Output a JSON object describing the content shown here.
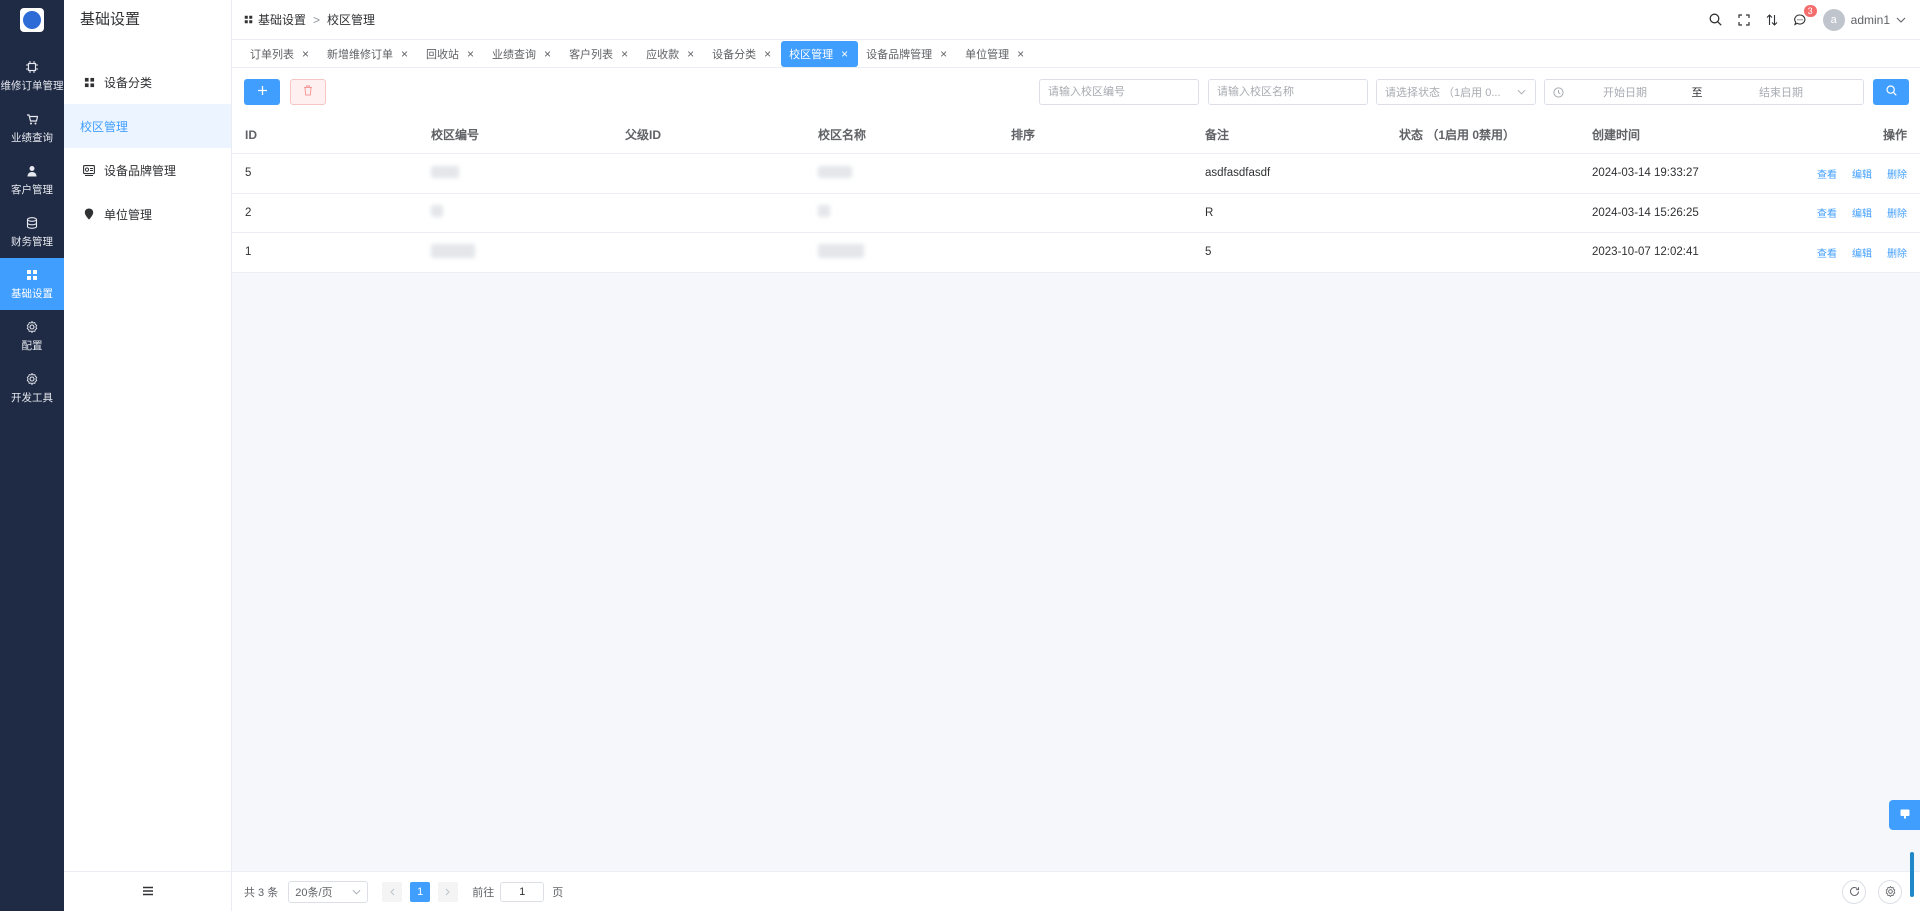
{
  "rail": {
    "items": [
      {
        "label": "维修订单管理",
        "icon": "chip-icon"
      },
      {
        "label": "业绩查询",
        "icon": "cart-icon"
      },
      {
        "label": "客户管理",
        "icon": "person-icon"
      },
      {
        "label": "财务管理",
        "icon": "database-icon"
      },
      {
        "label": "基础设置",
        "icon": "grid-icon"
      },
      {
        "label": "配置",
        "icon": "gear-icon"
      },
      {
        "label": "开发工具",
        "icon": "gear-icon"
      }
    ],
    "active_index": 4
  },
  "sidebar": {
    "title": "基础设置",
    "items": [
      {
        "label": "设备分类",
        "icon": "grid-icon"
      },
      {
        "label": "校区管理",
        "icon": ""
      },
      {
        "label": "设备品牌管理",
        "icon": "brand-icon"
      },
      {
        "label": "单位管理",
        "icon": "pin-icon"
      }
    ]
  },
  "header": {
    "breadcrumb": [
      "基础设置",
      "校区管理"
    ],
    "user": "admin1",
    "avatar_letter": "a",
    "notification_count": "3"
  },
  "tabs": [
    {
      "label": "订单列表"
    },
    {
      "label": "新增维修订单"
    },
    {
      "label": "回收站"
    },
    {
      "label": "业绩查询"
    },
    {
      "label": "客户列表"
    },
    {
      "label": "应收款"
    },
    {
      "label": "设备分类"
    },
    {
      "label": "校区管理",
      "active": true
    },
    {
      "label": "设备品牌管理"
    },
    {
      "label": "单位管理"
    }
  ],
  "filters": {
    "code_placeholder": "请输入校区编号",
    "name_placeholder": "请输入校区名称",
    "status_placeholder": "请选择状态 （1启用 0...",
    "start_date": "开始日期",
    "date_sep": "至",
    "end_date": "结束日期"
  },
  "table": {
    "columns": [
      "ID",
      "校区编号",
      "父级ID",
      "校区名称",
      "排序",
      "备注",
      "状态 （1启用 0禁用）",
      "创建时间",
      "操作"
    ],
    "rows": [
      {
        "id": "5",
        "remark": "asdfasdfasdf",
        "created": "2024-03-14 19:33:27"
      },
      {
        "id": "2",
        "remark": "R",
        "created": "2024-03-14 15:26:25"
      },
      {
        "id": "1",
        "remark": "5",
        "created": "2023-10-07 12:02:41"
      }
    ],
    "actions": {
      "view": "查看",
      "edit": "编辑",
      "delete": "删除"
    }
  },
  "pagination": {
    "total_text": "共 3 条",
    "page_size": "20条/页",
    "current_page": "1",
    "goto_label": "前往",
    "goto_value": "1",
    "page_unit": "页"
  },
  "colors": {
    "primary": "#409eff",
    "rail_bg": "#1f2a44",
    "danger": "#f56c6c"
  }
}
